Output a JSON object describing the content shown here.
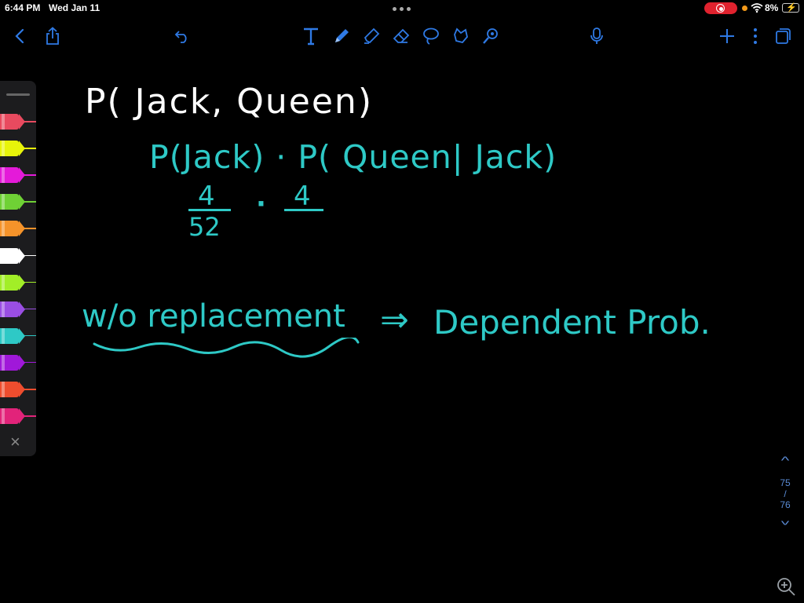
{
  "status": {
    "time": "6:44 PM",
    "date": "Wed Jan 11",
    "battery": "8%"
  },
  "toolbar": {
    "left_icons": [
      "back-icon",
      "share-icon"
    ],
    "center_icons": [
      "undo-icon",
      "text-tool-icon",
      "pen-tool-icon",
      "highlighter-icon",
      "eraser-icon",
      "lasso-icon",
      "shape-icon",
      "laser-pointer-icon"
    ],
    "right_icons": [
      "microphone-icon",
      "add-icon",
      "more-icon",
      "pages-icon"
    ]
  },
  "pens": {
    "colors": [
      "#e84a5f",
      "#e8f40a",
      "#e41ad9",
      "#6fd135",
      "#f5932a",
      "#ffffff",
      "#a2ee27",
      "#9a4ee3",
      "#2ec9c6",
      "#a018d9",
      "#ee4d2e",
      "#e2237a"
    ]
  },
  "note": {
    "line1": "P( Jack, Queen)",
    "line2": "P(Jack) · P( Queen| Jack)",
    "frac1_num": "4",
    "frac1_den": "52",
    "dot": "·",
    "frac2_num": "4",
    "line4_left": "w/o replacement",
    "arrow": "⇒",
    "line4_right": "Dependent Prob.",
    "ink_colors": {
      "white": "#ffffff",
      "teal": "#2ec9c6"
    }
  },
  "pager": {
    "current": "75",
    "separator": "/",
    "total": "76"
  }
}
